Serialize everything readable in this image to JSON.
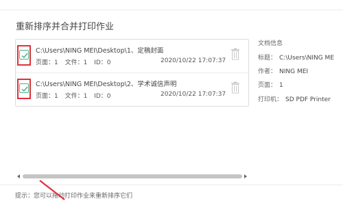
{
  "dialog": {
    "title": "重新排序并合并打印作业",
    "hint": "提示：您可以拖动打印作业来重新排序它们"
  },
  "jobs": [
    {
      "path": "C:\\Users\\NING MEI\\Desktop\\1、定稿封面",
      "pages": "页面：1",
      "files": "文件：1",
      "id": "ID：0",
      "date": "2020/10/22 17:07:37",
      "checked": true
    },
    {
      "path": "C:\\Users\\NING MEI\\Desktop\\2、学术诚信声明",
      "pages": "页面：1",
      "files": "文件：1",
      "id": "ID：0",
      "date": "2020/10/22 17:07:37",
      "checked": true
    }
  ],
  "doc_info": {
    "heading": "文档信息",
    "title_label": "标题：",
    "title_value": "C:\\Users\\NING ME",
    "author_label": "作者：",
    "author_value": "NING MEI",
    "pages_label": "页面：",
    "pages_value": "1",
    "printer_label": "打印机：",
    "printer_value": "SD PDF Printer"
  },
  "colors": {
    "check_accent": "#4caf82",
    "highlight_red": "#e0303a"
  },
  "icons": {
    "checkbox": "checkbox-checked-icon",
    "delete": "trash-icon",
    "scroll_left": "scroll-left-arrow-icon",
    "scroll_right": "scroll-right-arrow-icon"
  }
}
